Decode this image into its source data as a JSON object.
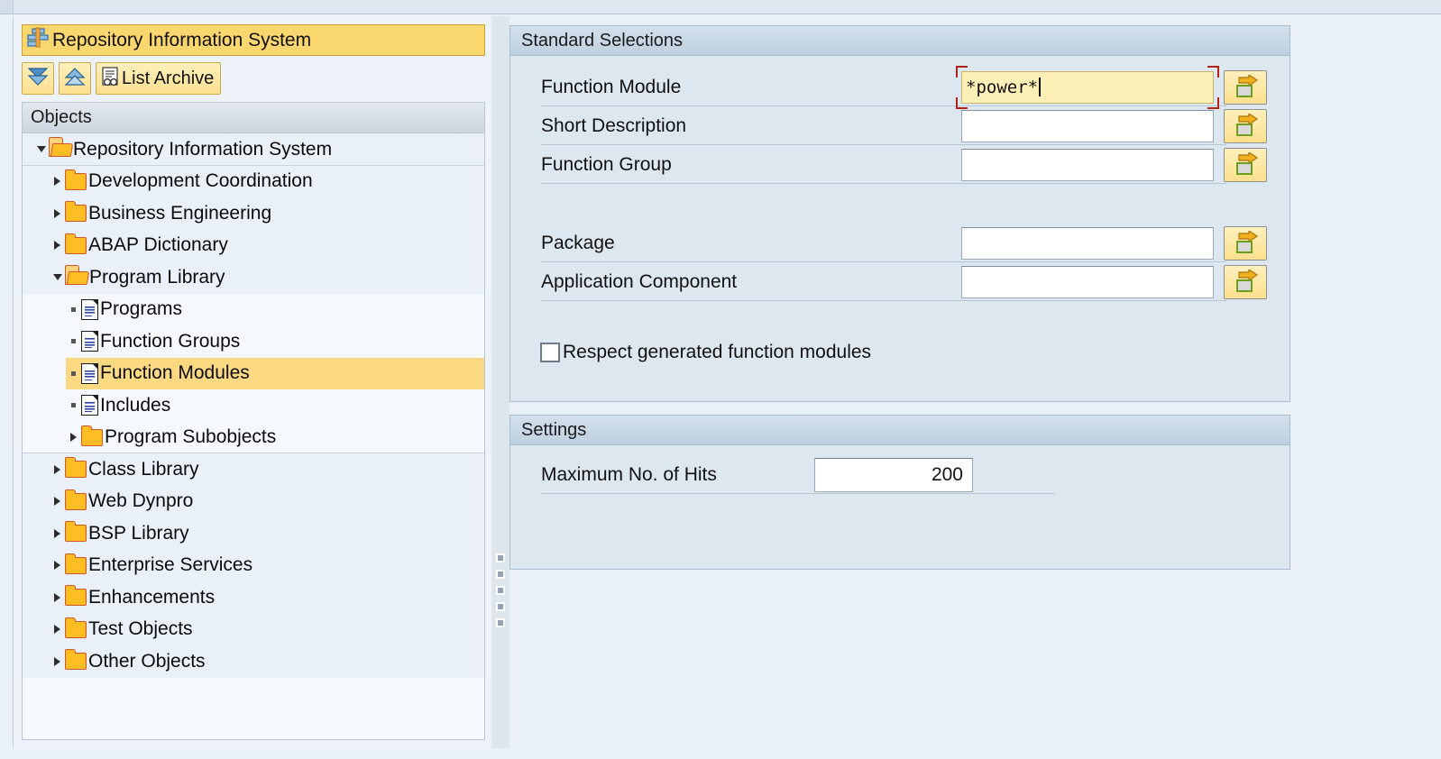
{
  "window": {
    "title": "Repository Information System",
    "title_icon": "repository-info-system-icon"
  },
  "toolbar": {
    "expand_all_icon": "expand-all-icon",
    "collapse_all_icon": "collapse-all-icon",
    "list_archive_icon": "list-archive-icon",
    "list_archive_label": "List Archive"
  },
  "tree": {
    "header": "Objects",
    "items": [
      {
        "label": "Repository Information System",
        "level": 0,
        "icon": "folder-open-icon",
        "expander": "down",
        "selected": false
      },
      {
        "label": "Development Coordination",
        "level": 1,
        "icon": "folder-closed-icon",
        "expander": "right",
        "selected": false
      },
      {
        "label": "Business Engineering",
        "level": 1,
        "icon": "folder-closed-icon",
        "expander": "right",
        "selected": false
      },
      {
        "label": "ABAP Dictionary",
        "level": 1,
        "icon": "folder-closed-icon",
        "expander": "right",
        "selected": false
      },
      {
        "label": "Program Library",
        "level": 1,
        "icon": "folder-open-icon",
        "expander": "down",
        "selected": false
      },
      {
        "label": "Programs",
        "level": 2,
        "icon": "document-icon",
        "expander": "dot",
        "selected": false
      },
      {
        "label": "Function Groups",
        "level": 2,
        "icon": "document-icon",
        "expander": "dot",
        "selected": false
      },
      {
        "label": "Function Modules",
        "level": 2,
        "icon": "document-icon",
        "expander": "dot",
        "selected": true
      },
      {
        "label": "Includes",
        "level": 2,
        "icon": "document-icon",
        "expander": "dot",
        "selected": false
      },
      {
        "label": "Program Subobjects",
        "level": 2,
        "icon": "folder-closed-icon",
        "expander": "right",
        "selected": false
      },
      {
        "label": "Class Library",
        "level": 1,
        "icon": "folder-closed-icon",
        "expander": "right",
        "selected": false
      },
      {
        "label": "Web Dynpro",
        "level": 1,
        "icon": "folder-closed-icon",
        "expander": "right",
        "selected": false
      },
      {
        "label": "BSP Library",
        "level": 1,
        "icon": "folder-closed-icon",
        "expander": "right",
        "selected": false
      },
      {
        "label": "Enterprise Services",
        "level": 1,
        "icon": "folder-closed-icon",
        "expander": "right",
        "selected": false
      },
      {
        "label": "Enhancements",
        "level": 1,
        "icon": "folder-closed-icon",
        "expander": "right",
        "selected": false
      },
      {
        "label": "Test Objects",
        "level": 1,
        "icon": "folder-closed-icon",
        "expander": "right",
        "selected": false
      },
      {
        "label": "Other Objects",
        "level": 1,
        "icon": "folder-closed-icon",
        "expander": "right",
        "selected": false
      }
    ]
  },
  "standard_selections": {
    "title": "Standard Selections",
    "fields": {
      "function_module": {
        "label": "Function Module",
        "value": "*power*",
        "focused": true
      },
      "short_description": {
        "label": "Short Description",
        "value": "",
        "focused": false
      },
      "function_group": {
        "label": "Function Group",
        "value": "",
        "focused": false
      },
      "package": {
        "label": "Package",
        "value": "",
        "focused": false
      },
      "application_component": {
        "label": "Application Component",
        "value": "",
        "focused": false
      }
    },
    "checkbox": {
      "label": "Respect generated function modules",
      "checked": false
    },
    "search_help_icon": "multiple-selection-icon"
  },
  "settings": {
    "title": "Settings",
    "max_hits": {
      "label": "Maximum No. of Hits",
      "value": "200"
    }
  },
  "colors": {
    "title_bar": "#fad66e",
    "selection_highlight": "#fbd982",
    "focus_frame": "#b32317",
    "group_background": "#dde7f0",
    "page_background": "#eaf0f7",
    "folder_icon": "#fcbe23"
  }
}
